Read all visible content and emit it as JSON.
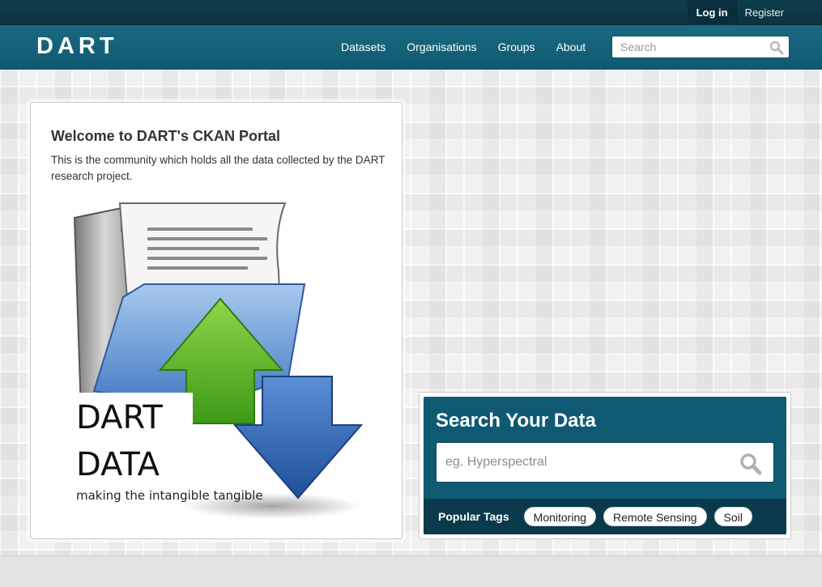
{
  "account": {
    "login_label": "Log in",
    "register_label": "Register"
  },
  "header": {
    "logo_text": "DART",
    "nav": [
      {
        "label": "Datasets"
      },
      {
        "label": "Organisations"
      },
      {
        "label": "Groups"
      },
      {
        "label": "About"
      }
    ],
    "search": {
      "placeholder": "Search",
      "icon": "search-icon"
    }
  },
  "welcome": {
    "title": "Welcome to DART's CKAN Portal",
    "description": "This is the community which holds all the data collected by the DART research project.",
    "image": {
      "line1": "DART",
      "line2": "DATA",
      "tagline": "making the intangible tangible"
    }
  },
  "search_panel": {
    "title": "Search Your Data",
    "placeholder": "eg. Hyperspectral",
    "icon": "search-icon",
    "popular_tags_label": "Popular Tags",
    "tags": [
      {
        "label": "Monitoring"
      },
      {
        "label": "Remote Sensing"
      },
      {
        "label": "Soil"
      }
    ]
  },
  "colors": {
    "header_dark": "#0f3d4c",
    "header_main": "#156278",
    "panel": "#0f5a72",
    "tags_bar": "#0a3a4b",
    "arrow_green": "#5fb82b",
    "arrow_blue": "#2f5fa8",
    "folder_blue": "#6aa2dd"
  }
}
